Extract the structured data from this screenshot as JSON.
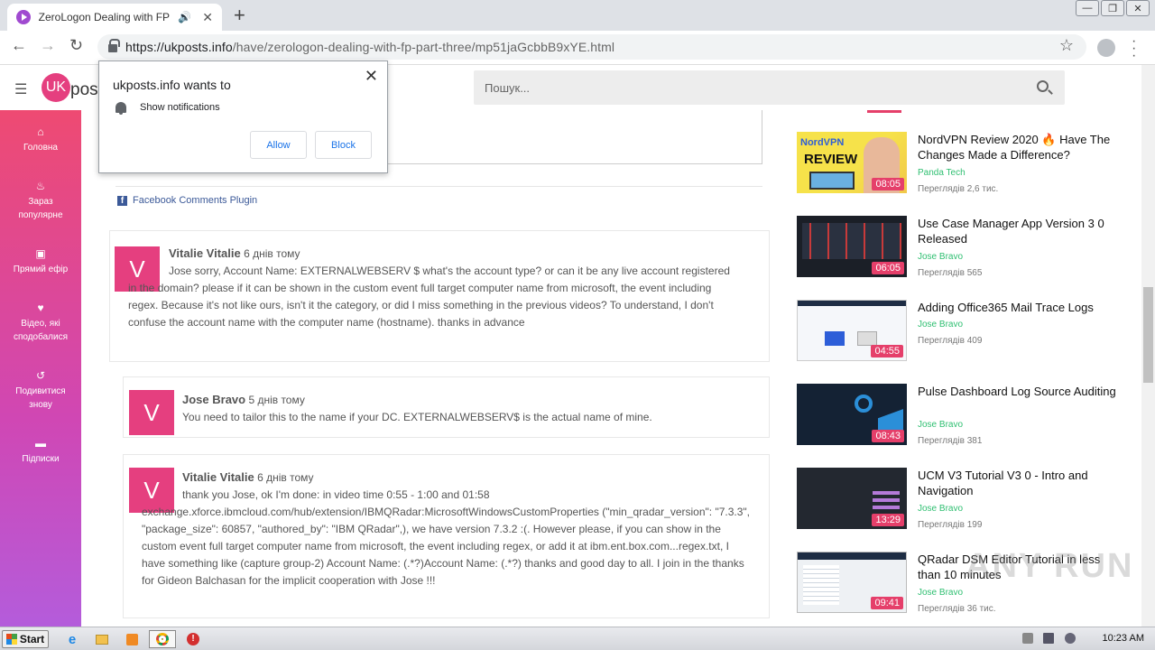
{
  "browser": {
    "tab_title": "ZeroLogon Dealing with FP part",
    "tab_audio": "🔊",
    "tab_close": "✕",
    "new_tab": "+",
    "url_host": "https://ukposts.info",
    "url_path": "/have/zerologon-dealing-with-fp-part-three/mp51jaGcbbB9xYE.html"
  },
  "site": {
    "logo": "UK",
    "logo_text": "posts",
    "search_placeholder": "Пошук..."
  },
  "popup": {
    "title": "ukposts.info wants to",
    "message": "Show notifications",
    "allow": "Allow",
    "block": "Block",
    "close": "✕"
  },
  "sidebar": {
    "items": [
      {
        "label": "Головна",
        "icon": "home-icon"
      },
      {
        "label": "Зараз популярне",
        "icon": "fire-icon"
      },
      {
        "label": "Прямий ефір",
        "icon": "live-icon"
      },
      {
        "label": "Відео, які сподобалися",
        "icon": "heart-icon"
      },
      {
        "label": "Подивитися знову",
        "icon": "history-icon"
      },
      {
        "label": "Підписки",
        "icon": "folder-icon"
      }
    ]
  },
  "fb_plugin": "Facebook Comments Plugin",
  "comments": [
    {
      "avatar": "V",
      "author": "Vitalie Vitalie",
      "time": "6 днів тому",
      "text": "Jose sorry, Account Name: EXTERNALWEBSERV $ what's the account type? or can it be any live account registered in the domain? please if it can be shown in the custom event full target computer name from microsoft, the event including regex. Because it's not like ours, isn't it the category, or did I miss something in the previous videos? To understand, I don't confuse the account name with the computer name (hostname). thanks in advance"
    },
    {
      "avatar": "V",
      "author": "Jose Bravo",
      "time": "5 днів тому",
      "text": "You need to tailor this to the name if your DC. EXTERNALWEBSERV$ is the actual name of mine."
    },
    {
      "avatar": "V",
      "author": "Vitalie Vitalie",
      "time": "6 днів тому",
      "text": "thank you Jose, ok I'm done: in video time 0:55 - 1:00 and 01:58 exchange.xforce.ibmcloud.com/hub/extension/IBMQRadar:MicrosoftWindowsCustomProperties (\"min_qradar_version\": \"7.3.3\", \"package_size\": 60857, \"authored_by\": \"IBM QRadar\",), we have version 7.3.2 :(. However please, if you can show in the custom event full target computer name from microsoft, the event including regex, or add it at ibm.ent.box.com...regex.txt, I have something like (capture group-2) Account Name: (.*?)Account Name: (.*?) thanks and good day to all. I join in the thanks for Gideon Balchasan for the implicit cooperation with Jose !!!"
    }
  ],
  "videos": [
    {
      "title": "NordVPN Review 2020 🔥 Have The Changes Made a Difference?",
      "channel": "Panda Tech",
      "views": "Переглядів 2,6 тис.",
      "duration": "08:05"
    },
    {
      "title": "Use Case Manager App Version 3 0 Released",
      "channel": "Jose Bravo",
      "views": "Переглядів 565",
      "duration": "06:05"
    },
    {
      "title": "Adding Office365 Mail Trace Logs",
      "channel": "Jose Bravo",
      "views": "Переглядів 409",
      "duration": "04:55"
    },
    {
      "title": "Pulse Dashboard Log Source Auditing",
      "channel": "Jose Bravo",
      "views": "Переглядів 381",
      "duration": "08:43"
    },
    {
      "title": "UCM V3 Tutorial V3 0 - Intro and Navigation",
      "channel": "Jose Bravo",
      "views": "Переглядів 199",
      "duration": "13:29"
    },
    {
      "title": "QRadar DSM Editor Tutorial in less than 10 minutes",
      "channel": "Jose Bravo",
      "views": "Переглядів 36 тис.",
      "duration": "09:41"
    }
  ],
  "taskbar": {
    "start": "Start",
    "clock": "10:23 AM"
  },
  "watermark": "ANY RUN"
}
